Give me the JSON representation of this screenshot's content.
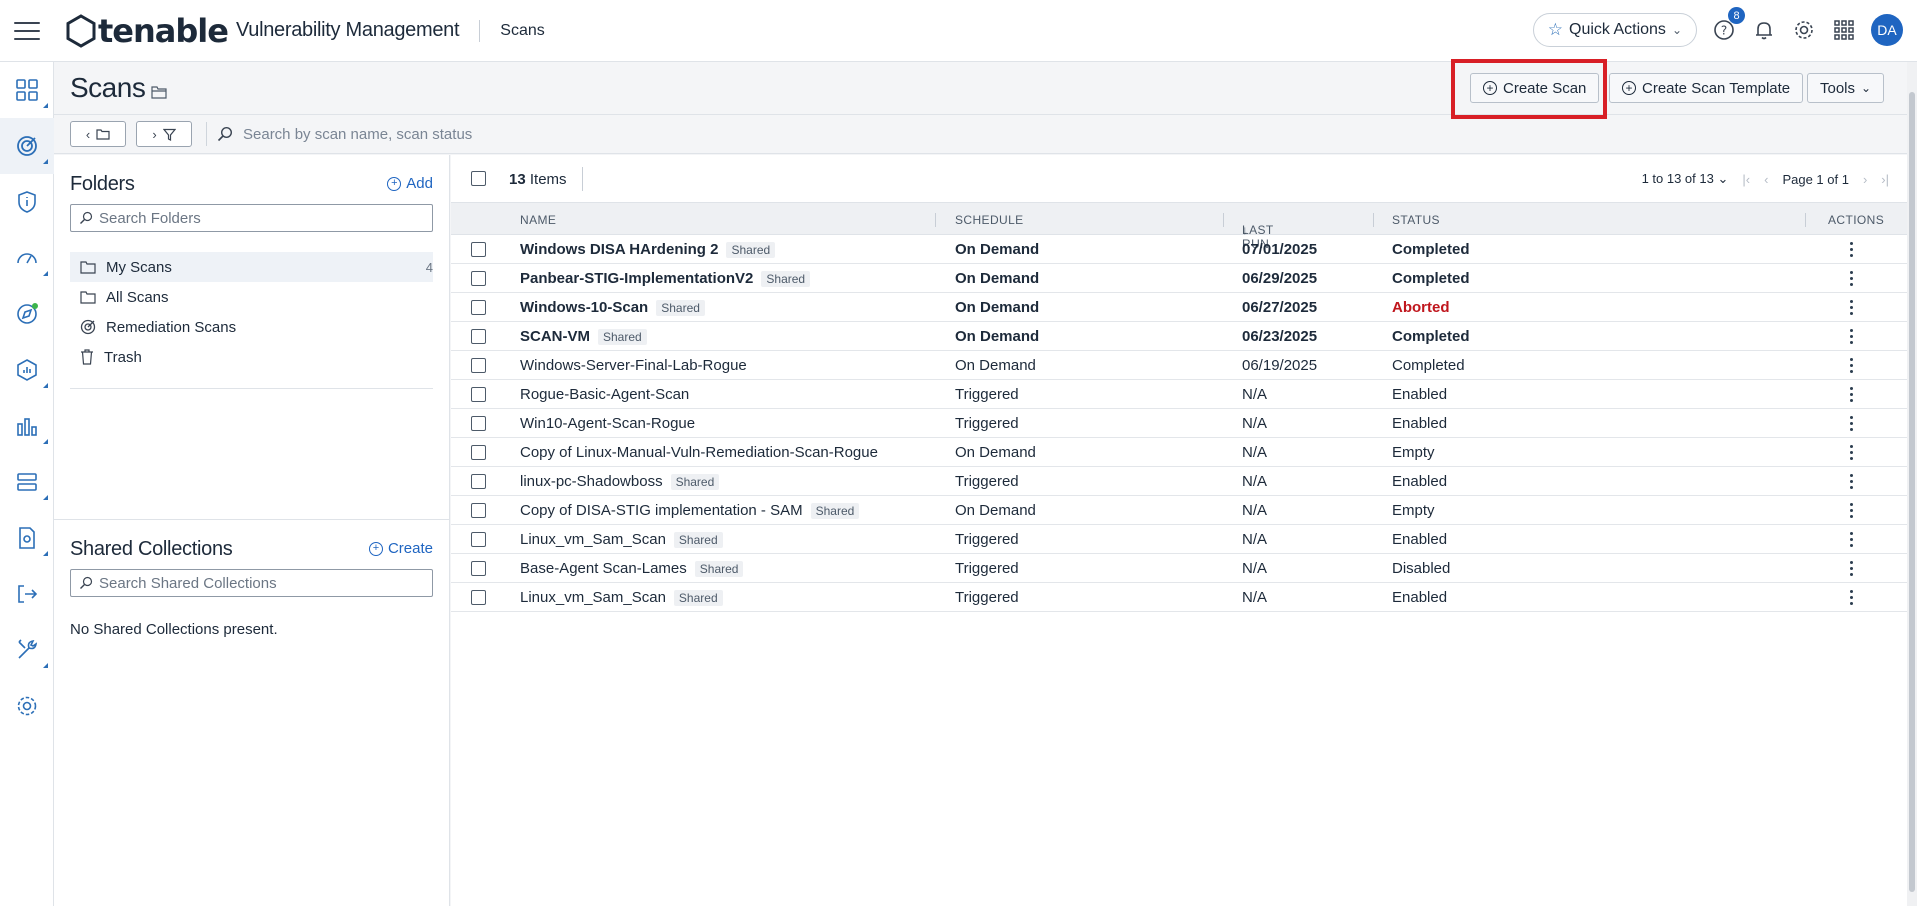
{
  "app": {
    "logo": "tenable",
    "product": "Vulnerability Management",
    "breadcrumb": "Scans"
  },
  "topbar": {
    "quick_actions": "Quick Actions",
    "help_badge": "8",
    "avatar_initials": "DA"
  },
  "nav_icons": [
    "dashboard-icon",
    "scans-icon",
    "info-shield-icon",
    "gauge-icon",
    "explore-icon",
    "exposure-icon",
    "analytics-icon",
    "assets-icon",
    "reports-icon",
    "export-icon",
    "tools-icon",
    "settings-icon"
  ],
  "page": {
    "title": "Scans",
    "create_scan": "Create Scan",
    "create_template": "Create Scan Template",
    "tools": "Tools"
  },
  "toolbar": {
    "search_placeholder": "Search by scan name, scan status"
  },
  "folders": {
    "title": "Folders",
    "add": "Add",
    "search_placeholder": "Search Folders",
    "items": [
      {
        "label": "My Scans",
        "count": "4"
      },
      {
        "label": "All Scans",
        "count": ""
      },
      {
        "label": "Remediation Scans",
        "count": ""
      },
      {
        "label": "Trash",
        "count": ""
      }
    ]
  },
  "shared_collections": {
    "title": "Shared Collections",
    "create": "Create",
    "search_placeholder": "Search Shared Collections",
    "empty": "No Shared Collections present."
  },
  "list": {
    "count": "13",
    "items_label": "Items",
    "pager_range": "1 to 13 of 13",
    "page_label": "Page 1 of 1",
    "columns": {
      "name": "NAME",
      "schedule": "SCHEDULE",
      "last_run": "LAST RUN",
      "status": "STATUS",
      "actions": "ACTIONS"
    },
    "shared_label": "Shared",
    "rows": [
      {
        "name": "Windows DISA HArdening 2",
        "shared": true,
        "schedule": "On Demand",
        "last_run": "07/01/2025",
        "status": "Completed",
        "bold": true
      },
      {
        "name": "Panbear-STIG-ImplementationV2",
        "shared": true,
        "schedule": "On Demand",
        "last_run": "06/29/2025",
        "status": "Completed",
        "bold": true
      },
      {
        "name": "Windows-10-Scan",
        "shared": true,
        "schedule": "On Demand",
        "last_run": "06/27/2025",
        "status": "Aborted",
        "bold": true
      },
      {
        "name": "SCAN-VM",
        "shared": true,
        "schedule": "On Demand",
        "last_run": "06/23/2025",
        "status": "Completed",
        "bold": true
      },
      {
        "name": "Windows-Server-Final-Lab-Rogue",
        "shared": false,
        "schedule": "On Demand",
        "last_run": "06/19/2025",
        "status": "Completed",
        "bold": false
      },
      {
        "name": "Rogue-Basic-Agent-Scan",
        "shared": false,
        "schedule": "Triggered",
        "last_run": "N/A",
        "status": "Enabled",
        "bold": false
      },
      {
        "name": "Win10-Agent-Scan-Rogue",
        "shared": false,
        "schedule": "Triggered",
        "last_run": "N/A",
        "status": "Enabled",
        "bold": false
      },
      {
        "name": "Copy of Linux-Manual-Vuln-Remediation-Scan-Rogue",
        "shared": false,
        "schedule": "On Demand",
        "last_run": "N/A",
        "status": "Empty",
        "bold": false
      },
      {
        "name": "linux-pc-Shadowboss",
        "shared": true,
        "schedule": "Triggered",
        "last_run": "N/A",
        "status": "Enabled",
        "bold": false
      },
      {
        "name": "Copy of DISA-STIG implementation - SAM",
        "shared": true,
        "schedule": "On Demand",
        "last_run": "N/A",
        "status": "Empty",
        "bold": false
      },
      {
        "name": "Linux_vm_Sam_Scan",
        "shared": true,
        "schedule": "Triggered",
        "last_run": "N/A",
        "status": "Enabled",
        "bold": false
      },
      {
        "name": "Base-Agent Scan-Lames",
        "shared": true,
        "schedule": "Triggered",
        "last_run": "N/A",
        "status": "Disabled",
        "bold": false
      },
      {
        "name": "Linux_vm_Sam_Scan",
        "shared": true,
        "schedule": "Triggered",
        "last_run": "N/A",
        "status": "Enabled",
        "bold": false
      }
    ]
  },
  "colors": {
    "accent": "#1f65c1",
    "aborted": "#c0161d",
    "highlight": "#d81f26"
  }
}
